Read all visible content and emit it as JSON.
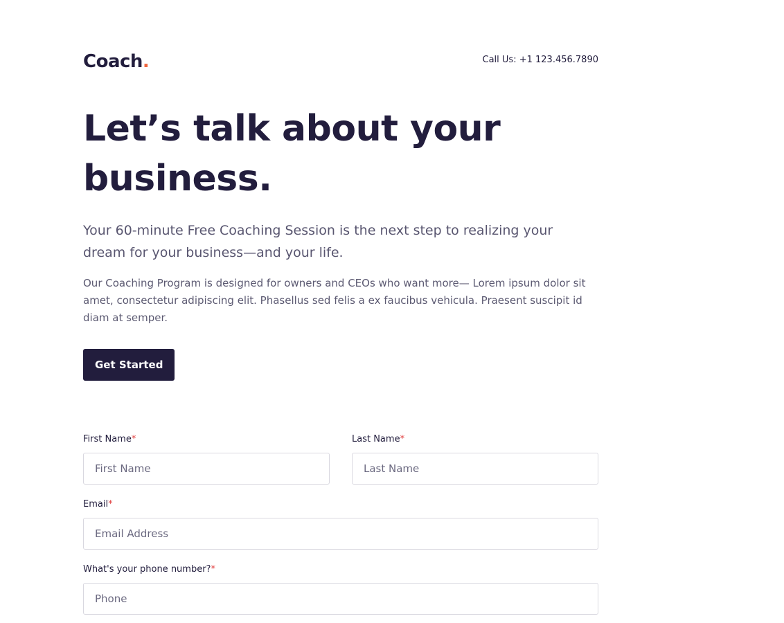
{
  "header": {
    "logo_text": "Coach",
    "logo_dot": ".",
    "call_label": "Call Us: ",
    "phone": "+1 123.456.7890"
  },
  "hero": {
    "headline_line1": "Let’s talk about your",
    "headline_line2": "business.",
    "lead": "Your 60-minute Free Coaching Session is the next step to realizing your dream for your business—and your life.",
    "body": "Our Coaching Program is designed for owners and CEOs who want more— Lorem ipsum dolor sit amet, consectetur adipiscing elit. Phasellus sed felis a ex faucibus vehicula. Praesent suscipit id diam at semper.",
    "cta_label": "Get Started"
  },
  "form": {
    "required_mark": "*",
    "first_name": {
      "label": "First Name",
      "placeholder": "First Name",
      "value": ""
    },
    "last_name": {
      "label": "Last Name",
      "placeholder": "Last Name",
      "value": ""
    },
    "email": {
      "label": "Email",
      "placeholder": "Email Address",
      "value": ""
    },
    "phone": {
      "label": "What's your phone number?",
      "placeholder": "Phone",
      "value": ""
    }
  },
  "colors": {
    "brand_dark": "#221d3d",
    "accent_orange": "#f0653d",
    "required_red": "#e03b3b",
    "muted_text": "#595670",
    "input_border": "#d9d8e0"
  }
}
